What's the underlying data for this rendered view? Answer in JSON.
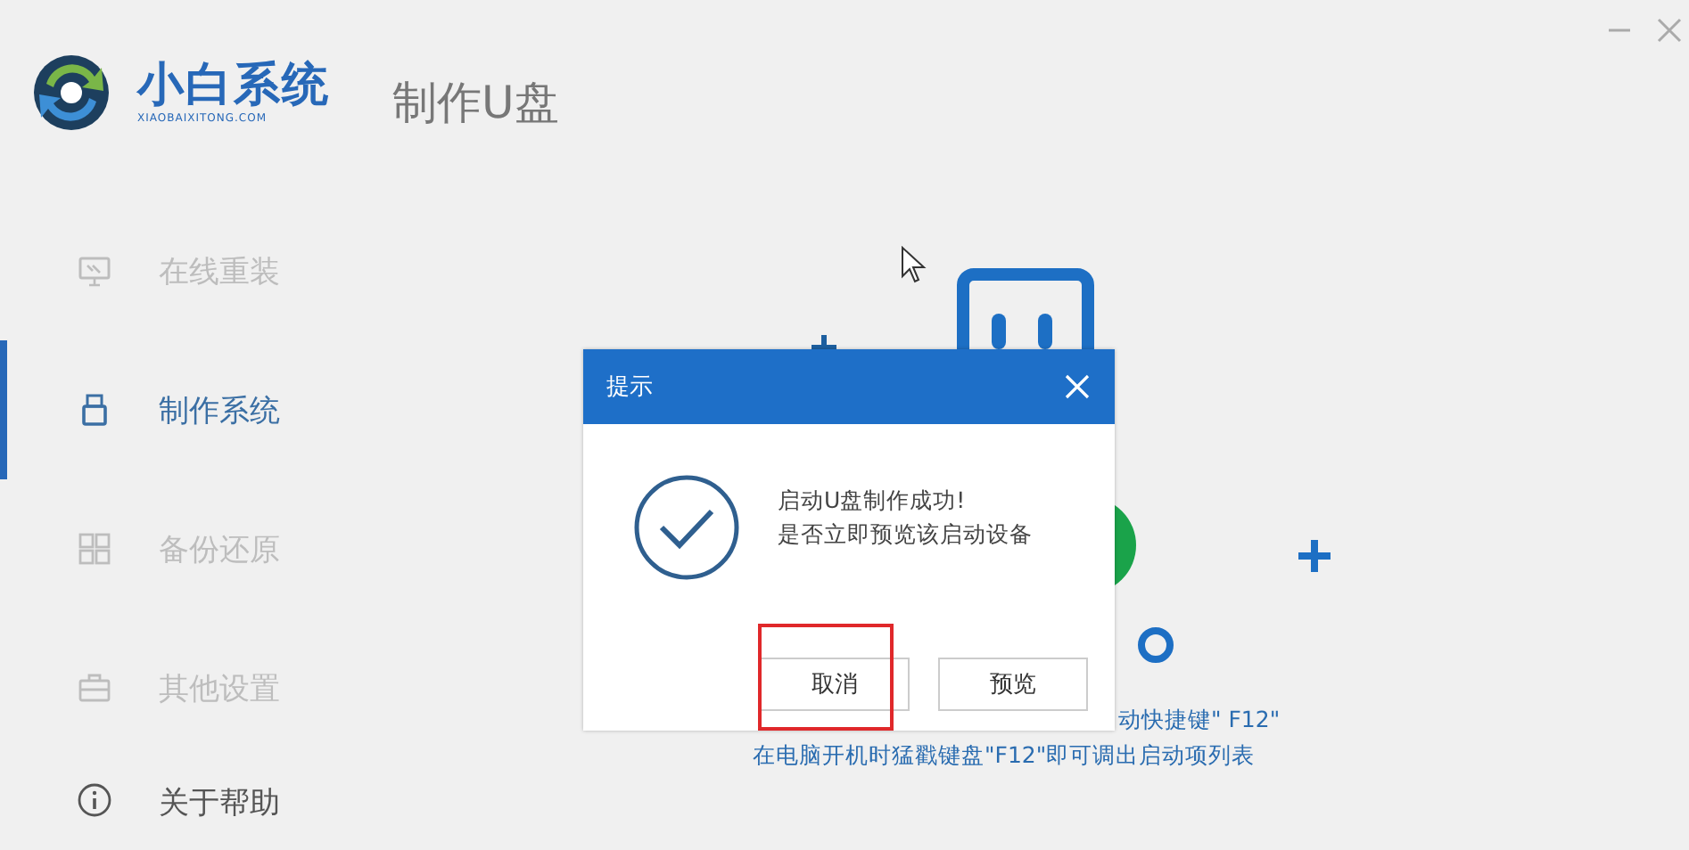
{
  "app": {
    "logo_title": "小白系统",
    "logo_subtitle": "XIAOBAIXITONG.COM",
    "page_title": "制作U盘"
  },
  "sidebar": {
    "items": [
      {
        "label": "在线重装",
        "kind": "monitor",
        "selected": false,
        "disabled": true
      },
      {
        "label": "制作系统",
        "kind": "usb",
        "selected": true,
        "disabled": false
      },
      {
        "label": "备份还原",
        "kind": "grid",
        "selected": false,
        "disabled": true
      },
      {
        "label": "其他设置",
        "kind": "case",
        "selected": false,
        "disabled": true
      },
      {
        "label": "关于帮助",
        "kind": "info",
        "selected": false,
        "disabled": false
      }
    ]
  },
  "hint_lines": [
    "动快捷键\" F12\"",
    "在电脑开机时猛戳键盘\"F12\"即可调出启动项列表"
  ],
  "dialog": {
    "title": "提示",
    "message": [
      "启动U盘制作成功!",
      "是否立即预览该启动设备"
    ],
    "buttons": [
      {
        "label": "取消",
        "highlighted": true
      },
      {
        "label": "预览",
        "highlighted": false
      }
    ]
  }
}
